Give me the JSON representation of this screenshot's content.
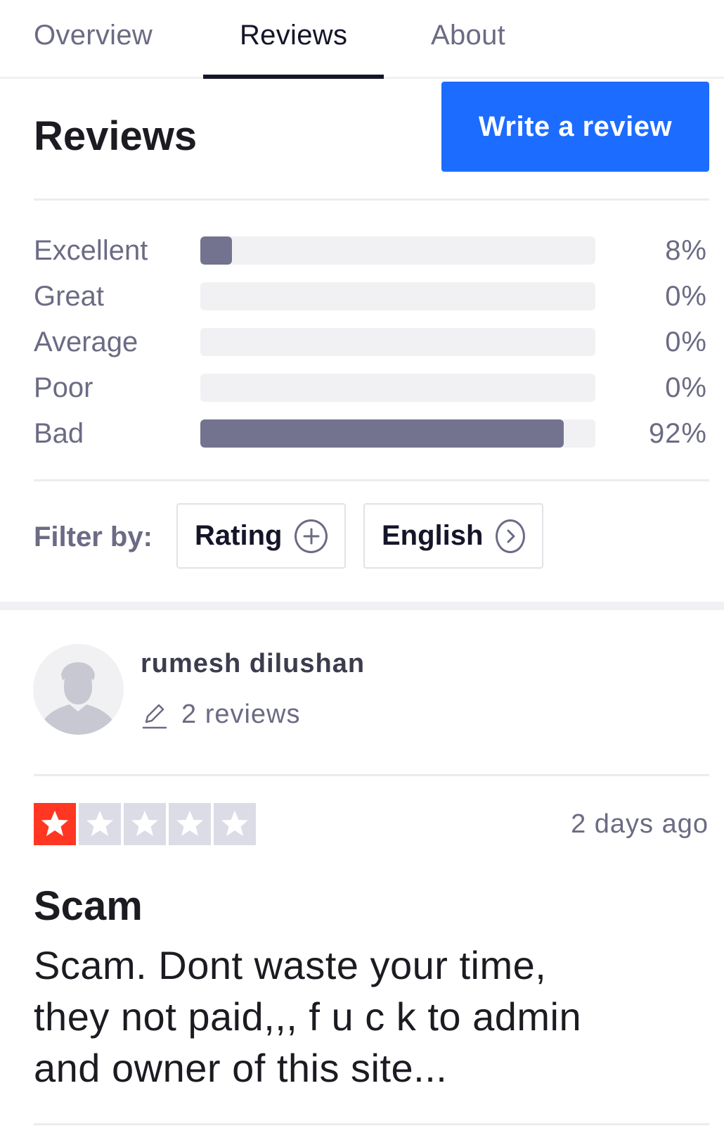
{
  "tabs": [
    {
      "label": "Overview",
      "active": false
    },
    {
      "label": "Reviews",
      "active": true
    },
    {
      "label": "About",
      "active": false
    }
  ],
  "section": {
    "title": "Reviews",
    "write_button_label": "Write a review"
  },
  "distribution": [
    {
      "label": "Excellent",
      "percent_text": "8%",
      "value": 8
    },
    {
      "label": "Great",
      "percent_text": "0%",
      "value": 0
    },
    {
      "label": "Average",
      "percent_text": "0%",
      "value": 0
    },
    {
      "label": "Poor",
      "percent_text": "0%",
      "value": 0
    },
    {
      "label": "Bad",
      "percent_text": "92%",
      "value": 92
    }
  ],
  "filter": {
    "label": "Filter by:",
    "rating_chip": {
      "label": "Rating",
      "icon": "plus-circle-icon"
    },
    "language_chip": {
      "label": "English",
      "icon": "chevron-right-circle-icon"
    }
  },
  "review": {
    "reviewer_name": "rumesh dilushan",
    "review_count": "2 reviews",
    "rating": 1,
    "max_rating": 5,
    "date": "2 days ago",
    "title": "Scam",
    "body_lines": [
      "Scam. Dont waste your time,",
      "they not paid,,, f u c k to admin",
      "and owner of this site..."
    ]
  },
  "colors": {
    "accent": "#1c6cff",
    "bar_fill": "#73738f",
    "star_on": "#ff3722",
    "star_off": "#dcdce6"
  }
}
